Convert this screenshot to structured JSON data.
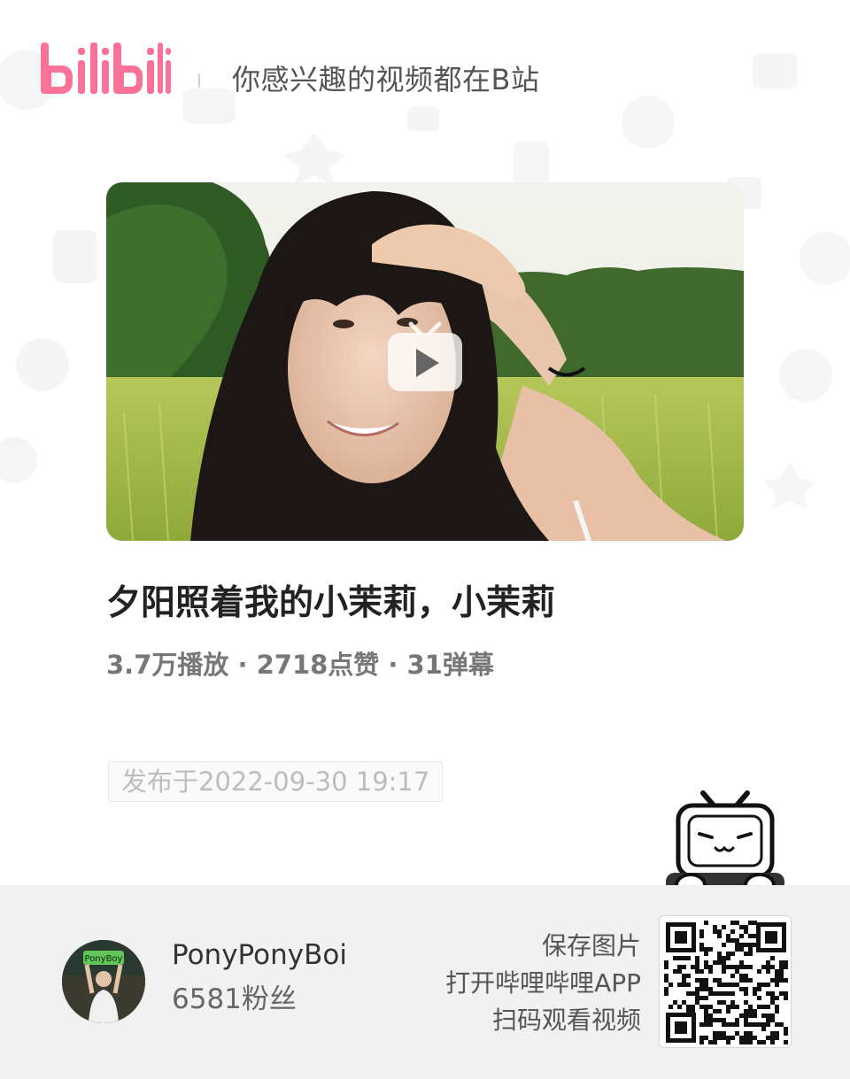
{
  "header": {
    "logo": "bilibili",
    "slogan": "你感兴趣的视频都在B站"
  },
  "video": {
    "title": "夕阳照着我的小茉莉，小茉莉",
    "stats": "3.7万播放 · 2718点赞 · 31弹幕",
    "publish_time": "发布于2022-09-30 19:17"
  },
  "uploader": {
    "name": "PonyPonyBoi",
    "fans": "6581粉丝",
    "avatar_sign_text": "PonyBoy"
  },
  "qr": {
    "save_image": "保存图片",
    "open_app": "打开哔哩哔哩APP",
    "scan_to_watch": "扫码观看视频"
  },
  "colors": {
    "brand_pink": "#fb7299",
    "background": "#ffffff",
    "footer_background": "#f1f1f1"
  },
  "icons": {
    "logo": "bilibili-logo",
    "play": "bilibili-tv-play-icon",
    "mascot": "bilibili-tv-mascot"
  }
}
